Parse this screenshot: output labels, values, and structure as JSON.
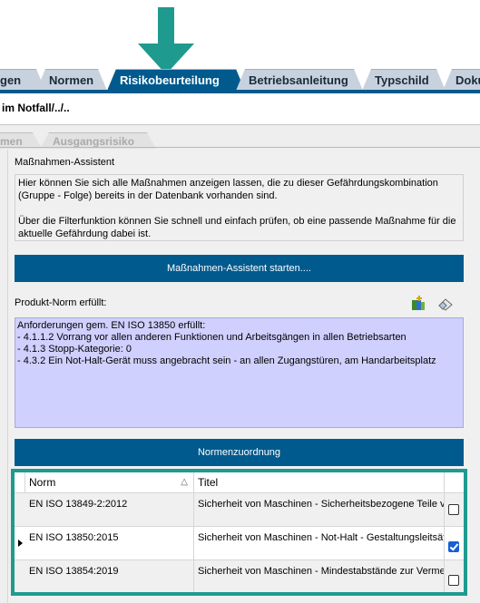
{
  "tabs": [
    {
      "label": "gen"
    },
    {
      "label": "Normen"
    },
    {
      "label": "Risikobeurteilung"
    },
    {
      "label": "Betriebsanleitung"
    },
    {
      "label": "Typschild"
    },
    {
      "label": "Doku"
    }
  ],
  "breadcrumb": "im Notfall/../..",
  "subtabs": [
    {
      "label": "men"
    },
    {
      "label": "Ausgangsrisiko"
    }
  ],
  "assistant": {
    "title": "Maßnahmen-Assistent",
    "text1": "Hier können Sie sich alle Maßnahmen anzeigen lassen, die zu dieser Gefährdungskombination (Gruppe - Folge) bereits in der Datenbank vorhanden sind.",
    "text2": "Über die Filterfunktion können Sie schnell und einfach prüfen, ob eine passende Maßnahme für die aktuelle Gefährdung dabei ist.",
    "button": "Maßnahmen-Assistent starten...."
  },
  "product_norm": {
    "label": "Produkt-Norm erfüllt:",
    "lines": [
      "Anforderungen gem. EN ISO 13850 erfüllt:",
      "- 4.1.1.2  Vorrang vor allen anderen Funktionen und Arbeitsgängen in allen Betriebsarten",
      "- 4.1.3 Stopp-Kategorie: 0",
      "- 4.3.2 Ein Not-Halt-Gerät muss angebracht sein - an allen Zugangstüren, am Handarbeitsplatz"
    ],
    "icons": [
      "book-add-icon",
      "eraser-icon"
    ]
  },
  "normenzuordnung_button": "Normenzuordnung",
  "table": {
    "columns": [
      "Norm",
      "Titel"
    ],
    "sort_indicator": "△",
    "rows": [
      {
        "norm": "EN ISO 13849-2:2012",
        "titel": "Sicherheit von Maschinen - Sicherheitsbezogene Teile von",
        "checked": false
      },
      {
        "norm": "EN ISO 13850:2015",
        "titel": "Sicherheit von Maschinen - Not-Halt - Gestaltungsleitsätz",
        "checked": true
      },
      {
        "norm": "EN ISO 13854:2019",
        "titel": "Sicherheit von Maschinen - Mindestabstände zur Vermeid",
        "checked": false
      }
    ]
  },
  "colors": {
    "tab_active": "#005a8e",
    "tab_inactive": "#c7d2de",
    "arrow": "#1f9a8f",
    "requirements_bg": "#d0d0ff",
    "checkbox_checked": "#1560d4"
  }
}
